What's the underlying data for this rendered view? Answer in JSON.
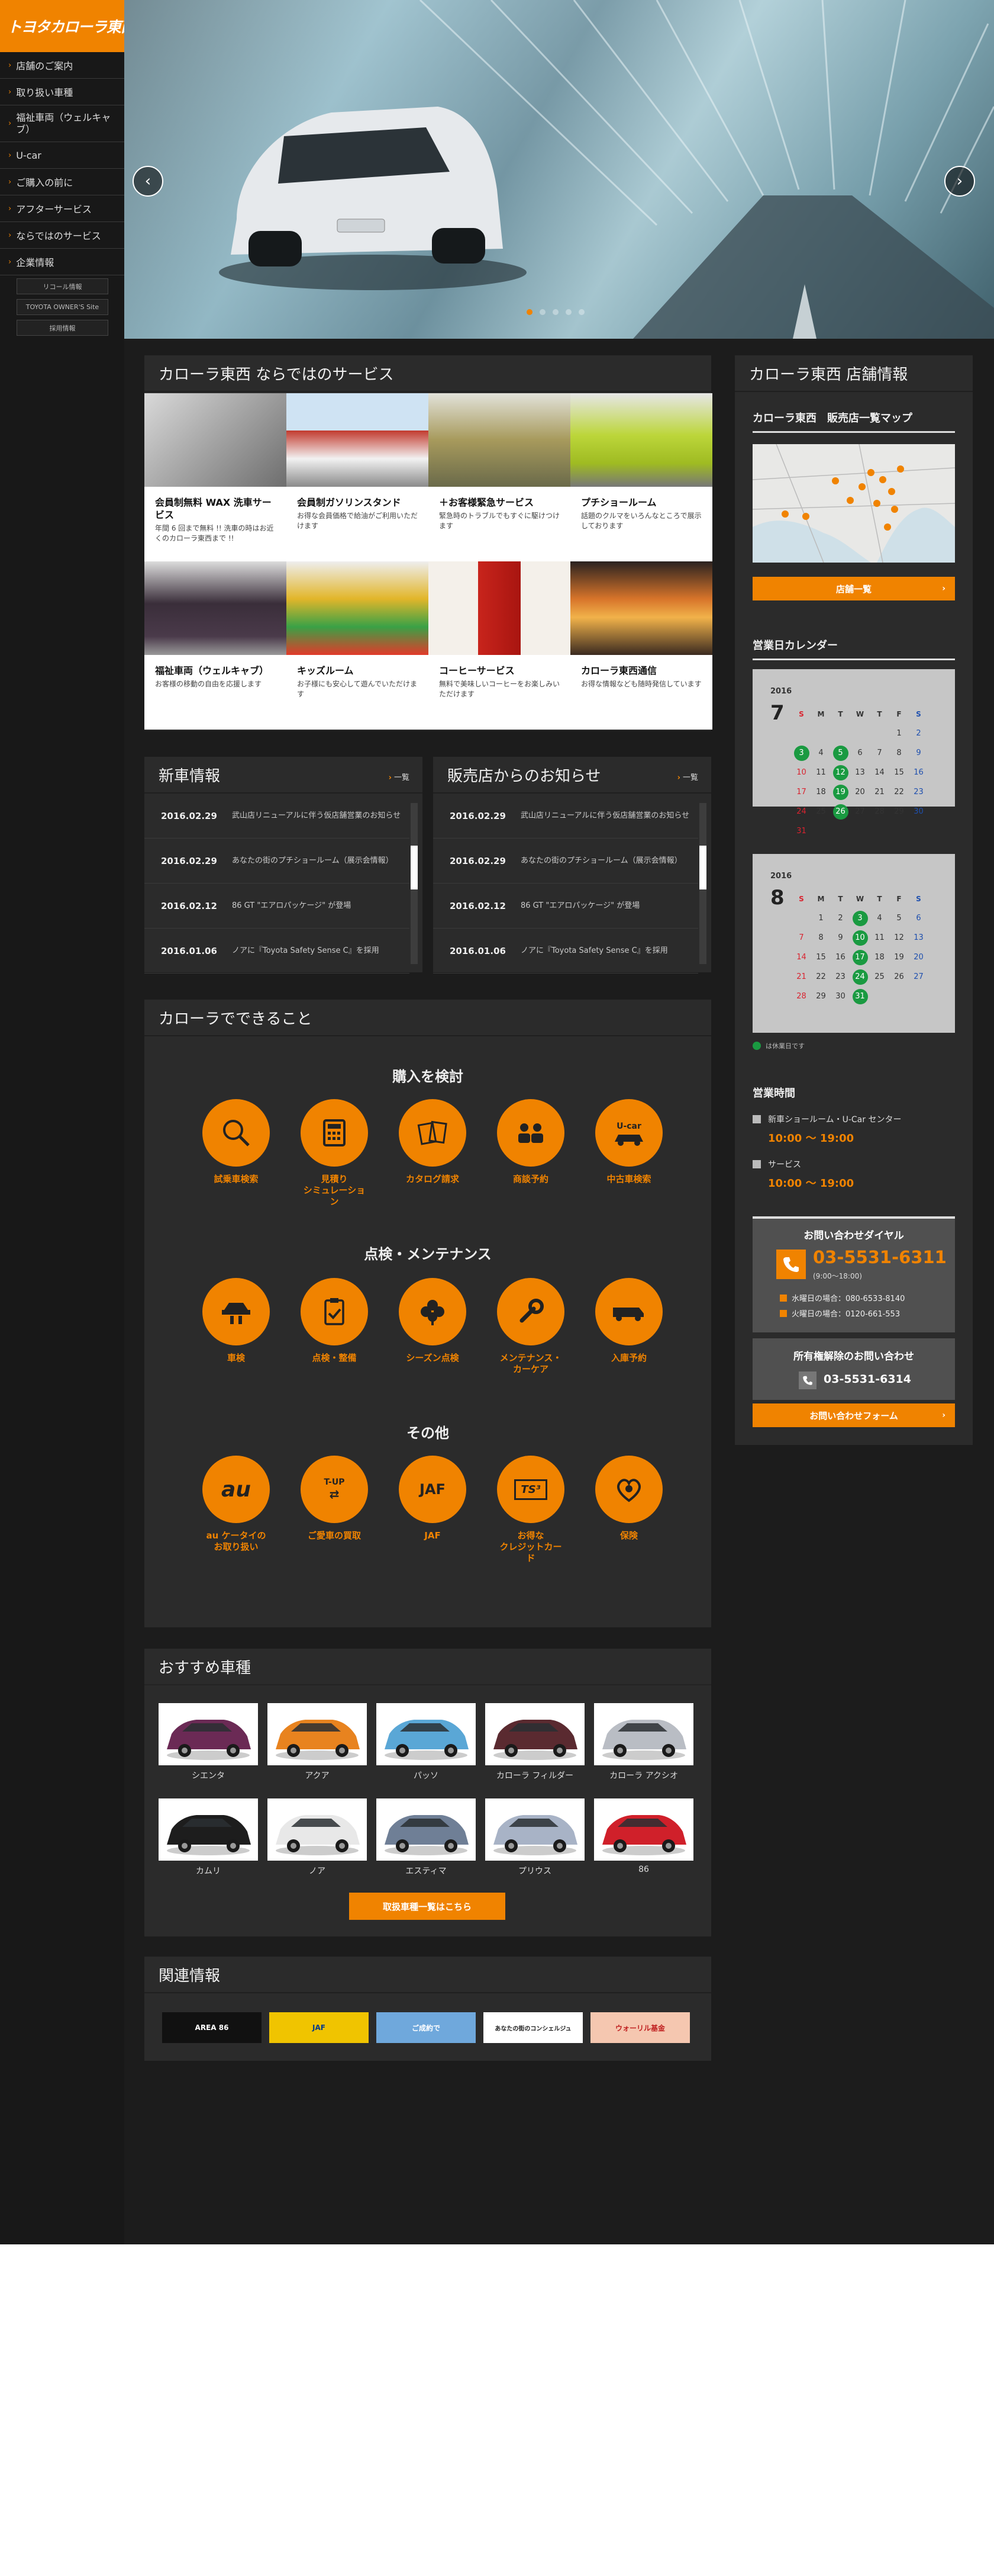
{
  "brand": {
    "logo_text": "トヨタカローラ東西",
    "accent": "#f08300",
    "holiday_green": "#1a9a41"
  },
  "nav": {
    "items": [
      {
        "label": "店舗のご案内"
      },
      {
        "label": "取り扱い車種"
      },
      {
        "label": "福祉車両（ウェルキャブ）"
      },
      {
        "label": "U-car"
      },
      {
        "label": "ご購入の前に"
      },
      {
        "label": "アフターサービス"
      },
      {
        "label": "ならではのサービス"
      },
      {
        "label": "企業情報"
      }
    ],
    "links": [
      {
        "label": "リコール情報"
      },
      {
        "label": "TOYOTA OWNER'S Site"
      },
      {
        "label": "採用情報"
      }
    ]
  },
  "hero": {
    "prev": "‹",
    "next": "›",
    "slides": 5,
    "active": 1
  },
  "services": {
    "title": "カローラ東西 ならではのサービス",
    "items": [
      {
        "title": "会員制無料 WAX 洗車サービス",
        "desc": "年間 6 回まで無料 !! 洗車の時はお近くのカローラ東西まで !!"
      },
      {
        "title": "会員制ガソリンスタンド",
        "desc": "お得な会員価格で給油がご利用いただけます"
      },
      {
        "title": "＋お客様緊急サービス",
        "desc": "緊急時のトラブルでもすぐに駆けつけます"
      },
      {
        "title": "プチショールーム",
        "desc": "話題のクルマをいろんなところで展示しております"
      },
      {
        "title": "福祉車両（ウェルキャブ）",
        "desc": "お客様の移動の自由を応援します"
      },
      {
        "title": "キッズルーム",
        "desc": "お子様にも安心して遊んでいただけます"
      },
      {
        "title": "コーヒーサービス",
        "desc": "無料で美味しいコーヒーをお楽しみいただけます"
      },
      {
        "title": "カローラ東西通信",
        "desc": "お得な情報なども随時発信しています"
      }
    ]
  },
  "new_car_news": {
    "title": "新車情報",
    "more": "一覧",
    "rows": [
      {
        "date": "2016.02.29",
        "text": "武山店リニューアルに伴う仮店舗営業のお知らせ"
      },
      {
        "date": "2016.02.29",
        "text": "あなたの街のプチショールーム（展示会情報）"
      },
      {
        "date": "2016.02.12",
        "text": "86 GT \"エアロパッケージ\" が登場"
      },
      {
        "date": "2016.01.06",
        "text": "ノアに『Toyota Safety Sense C』を採用"
      }
    ]
  },
  "dealer_news": {
    "title": "販売店からのお知らせ",
    "more": "一覧",
    "rows": [
      {
        "date": "2016.02.29",
        "text": "武山店リニューアルに伴う仮店舗営業のお知らせ"
      },
      {
        "date": "2016.02.29",
        "text": "あなたの街のプチショールーム（展示会情報）"
      },
      {
        "date": "2016.02.12",
        "text": "86 GT \"エアロパッケージ\" が登場"
      },
      {
        "date": "2016.01.06",
        "text": "ノアに『Toyota Safety Sense C』を採用"
      }
    ]
  },
  "can_do": {
    "title": "カローラでできること",
    "categories": [
      {
        "title": "購入を検討",
        "items": [
          {
            "label": "試乗車検索",
            "icon": "magnifier-icon"
          },
          {
            "label": "見積り\nシミュレーション",
            "icon": "calculator-icon"
          },
          {
            "label": "カタログ請求",
            "icon": "catalog-icon"
          },
          {
            "label": "商談予約",
            "icon": "meeting-icon"
          },
          {
            "label": "中古車検索",
            "icon": "ucar-icon"
          }
        ]
      },
      {
        "title": "点検・メンテナンス",
        "items": [
          {
            "label": "車検",
            "icon": "car-lift-icon"
          },
          {
            "label": "点検・整備",
            "icon": "clipboard-icon"
          },
          {
            "label": "シーズン点検",
            "icon": "clover-icon"
          },
          {
            "label": "メンテナンス・\nカーケア",
            "icon": "wrench-icon"
          },
          {
            "label": "入庫予約",
            "icon": "tow-truck-icon"
          }
        ]
      },
      {
        "title": "その他",
        "items": [
          {
            "label": "au ケータイの\nお取り扱い",
            "icon": "au-icon",
            "glyph": "au"
          },
          {
            "label": "ご愛車の買取",
            "icon": "trade-in-icon",
            "glyph": "T-UP"
          },
          {
            "label": "JAF",
            "icon": "jaf-icon",
            "glyph": "JAF"
          },
          {
            "label": "お得な\nクレジットカード",
            "icon": "ts3-card-icon",
            "glyph": "TS³"
          },
          {
            "label": "保険",
            "icon": "insurance-heart-icon"
          }
        ]
      }
    ]
  },
  "recommended": {
    "title": "おすすめ車種",
    "cars": [
      {
        "name": "シエンタ",
        "color": "#6b2a55"
      },
      {
        "name": "アクア",
        "color": "#e8831f"
      },
      {
        "name": "パッソ",
        "color": "#5aa7d6"
      },
      {
        "name": "カローラ フィルダー",
        "color": "#5a2a30"
      },
      {
        "name": "カローラ アクシオ",
        "color": "#b9bdc4"
      },
      {
        "name": "カムリ",
        "color": "#1d1d1d"
      },
      {
        "name": "ノア",
        "color": "#e8e8e8"
      },
      {
        "name": "エスティマ",
        "color": "#6f7f96"
      },
      {
        "name": "プリウス",
        "color": "#a8b3c6"
      },
      {
        "name": "86",
        "color": "#d0202a"
      }
    ],
    "button": "取扱車種一覧はこちら"
  },
  "related": {
    "title": "関連情報",
    "banners": [
      {
        "label": "AREA 86",
        "bg": "#111111",
        "fg": "#ffffff"
      },
      {
        "label": "JAF",
        "bg": "#f0c400",
        "fg": "#003a8c"
      },
      {
        "label": "ご成約で",
        "bg": "#6fa8dc",
        "fg": "#ffffff"
      },
      {
        "label": "あなたの街のコンシェルジュ",
        "bg": "#ffffff",
        "fg": "#222222"
      },
      {
        "label": "ウォーリル基金",
        "bg": "#f5c7b0",
        "fg": "#c02020"
      }
    ]
  },
  "store": {
    "title": "カローラ東西 店舗情報",
    "map_title": "カローラ東西　販売店一覧マップ",
    "store_list_button": "店舗一覧",
    "calendar_title": "営業日カレンダー",
    "weekdays": [
      "S",
      "M",
      "T",
      "W",
      "T",
      "F",
      "S"
    ],
    "calendars": [
      {
        "year": "2016",
        "month": "7",
        "start": 5,
        "days": 31,
        "holidays": [
          3,
          5,
          12,
          19,
          26
        ]
      },
      {
        "year": "2016",
        "month": "8",
        "start": 1,
        "days": 31,
        "holidays": [
          3,
          10,
          17,
          24,
          31
        ]
      }
    ],
    "legend": "は休業日です",
    "hours_title": "営業時間",
    "hours": [
      {
        "label": "新車ショールーム・U-Car センター",
        "time": "10:00 〜 19:00"
      },
      {
        "label": "サービス",
        "time": "10:00 〜 19:00"
      }
    ],
    "dial": {
      "title": "お問い合わせダイヤル",
      "number": "03-5531-6311",
      "hours": "(9:00〜18:00)",
      "note1": "水曜日の場合：080-6533-8140",
      "note2": "火曜日の場合：0120-661-553"
    },
    "cancel": {
      "title": "所有権解除のお問い合わせ",
      "number": "03-5531-6314"
    },
    "form_button": "お問い合わせフォーム"
  }
}
